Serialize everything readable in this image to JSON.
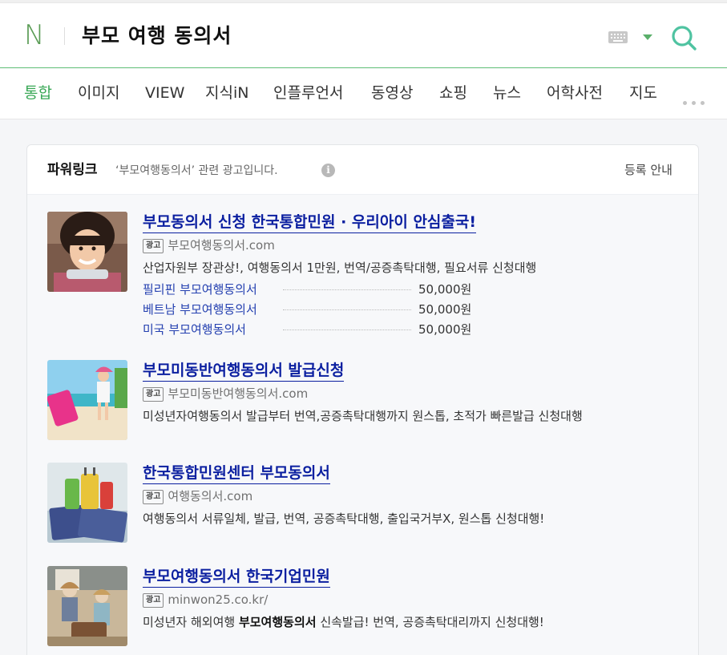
{
  "header": {
    "logo": "N",
    "query": "부모 여행 동의서"
  },
  "tabs": [
    {
      "label": "통합",
      "active": true
    },
    {
      "label": "이미지"
    },
    {
      "label": "VIEW"
    },
    {
      "label": "지식iN"
    },
    {
      "label": "인플루언서"
    },
    {
      "label": "동영상"
    },
    {
      "label": "쇼핑"
    },
    {
      "label": "뉴스"
    },
    {
      "label": "어학사전"
    },
    {
      "label": "지도"
    }
  ],
  "powerlink": {
    "title": "파워링크",
    "description": "‘부모여행동의서’ 관련 광고입니다.",
    "info_icon": "i",
    "register_label": "등록 안내"
  },
  "ads": [
    {
      "title": "부모동의서 신청 한국통합민원 · 우리아이 안심출국!",
      "badge": "광고",
      "url": "부모여행동의서.com",
      "description": "산업자원부 장관상!, 여행동의서 1만원, 번역/공증촉탁대행, 필요서류 신청대행",
      "sub_links": [
        {
          "name": "필리핀 부모여행동의서",
          "price": "50,000원"
        },
        {
          "name": "베트남 부모여행동의서",
          "price": "50,000원"
        },
        {
          "name": "미국 부모여행동의서",
          "price": "50,000원"
        }
      ]
    },
    {
      "title": "부모미동반여행동의서 발급신청",
      "badge": "광고",
      "url": "부모미동반여행동의서.com",
      "description": "미성년자여행동의서 발급부터 번역,공증촉탁대행까지 원스톱, 초적가 빠른발급 신청대행"
    },
    {
      "title": "한국통합민원센터 부모동의서",
      "badge": "광고",
      "url": "여행동의서.com",
      "description": "여행동의서 서류일체, 발급, 번역, 공증촉탁대행, 출입국거부X, 원스톱 신청대행!"
    },
    {
      "title": "부모여행동의서 한국기업민원",
      "badge": "광고",
      "url": "minwon25.co.kr/",
      "description_pre": "미성년자 해외여행 ",
      "description_bold": "부모여행동의서",
      "description_post": " 신속발급! 번역, 공증촉탁대리까지 신청대행!"
    }
  ],
  "colors": {
    "accent_green": "#3aa857",
    "link_blue": "#0b1fa0"
  }
}
